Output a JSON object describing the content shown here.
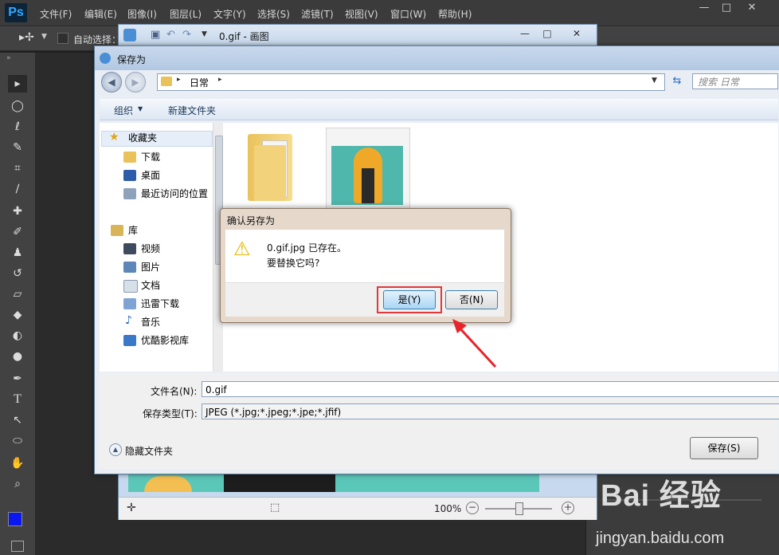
{
  "ps": {
    "logo": "Ps",
    "menus": [
      "文件(F)",
      "编辑(E)",
      "图像(I)",
      "图层(L)",
      "文字(Y)",
      "选择(S)",
      "滤镜(T)",
      "视图(V)",
      "窗口(W)",
      "帮助(H)"
    ],
    "options": {
      "auto_select": "自动选择："
    },
    "window_controls": {
      "minimize": "—",
      "maximize": "□",
      "close": "✕"
    }
  },
  "paint": {
    "title": "0.gif - 画图",
    "zoom": "100%"
  },
  "save_dialog": {
    "title": "保存为",
    "address": "日常",
    "search_placeholder": "搜索 日常",
    "organize": "组织",
    "new_folder": "新建文件夹",
    "nav": {
      "favorites": "收藏夹",
      "downloads": "下载",
      "desktop": "桌面",
      "recent": "最近访问的位置",
      "libraries": "库",
      "videos": "视频",
      "pictures": "图片",
      "documents": "文档",
      "xunlei": "迅雷下载",
      "music": "音乐",
      "youku": "优酷影视库"
    },
    "filename_label": "文件名(N):",
    "filename_value": "0.gif",
    "filetype_label": "保存类型(T):",
    "filetype_value": "JPEG (*.jpg;*.jpeg;*.jpe;*.jfif)",
    "hide_folders": "隐藏文件夹",
    "save_button": "保存(S)"
  },
  "confirm": {
    "title": "确认另存为",
    "line1": "0.gif.jpg 已存在。",
    "line2": "要替换它吗?",
    "yes": "是(Y)",
    "no": "否(N)"
  },
  "colors": {
    "highlight": "#e0383b",
    "arrow": "#e8232a",
    "foreground": "#0a17f0"
  },
  "watermark": {
    "brand": "Bai 经验",
    "url": "jingyan.baidu.com"
  }
}
